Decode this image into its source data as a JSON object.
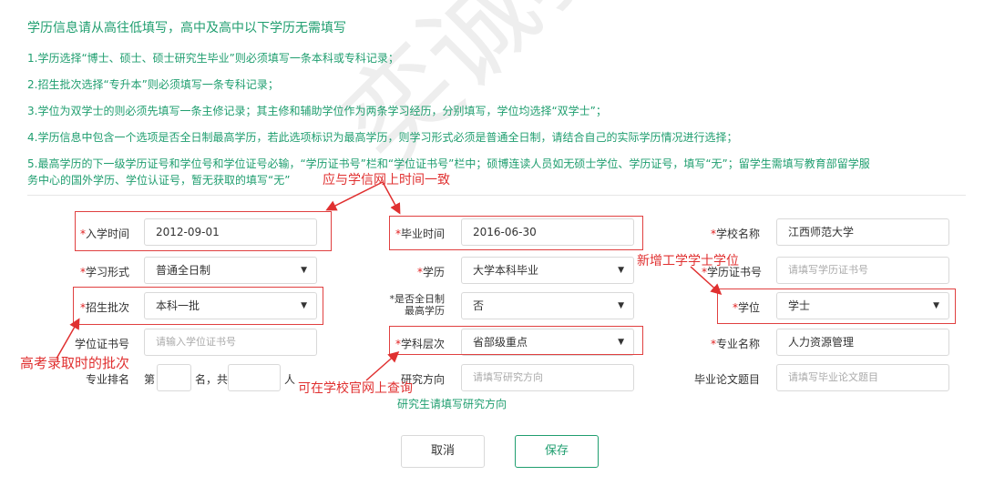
{
  "header": {
    "title": "学历信息请从高往低填写，高中及高中以下学历无需填写"
  },
  "notes": [
    "1.学历选择“博士、硕士、硕士研究生毕业”则必须填写一条本科或专科记录；",
    "2.招生批次选择“专升本”则必须填写一条专科记录；",
    "3.学位为双学士的则必须先填写一条主修记录；其主修和辅助学位作为两条学习经历，分别填写，学位均选择“双学士”；",
    "4.学历信息中包含一个选项是否全日制最高学历，若此选项标识为最高学历，则学习形式必须是普通全日制，请结合自己的实际学历情况进行选择；",
    "5.最高学历的下一级学历证号和学位号和学位证号必输，“学历证书号”栏和“学位证书号”栏中；硕博连读人员如无硕士学位、学历证号，填写“无”；留学生需填写教育部留学服",
    "务中心的国外学历、学位认证号，暂无获取的填写“无”"
  ],
  "form": {
    "enroll_time": {
      "label": "入学时间",
      "value": "2012-09-01"
    },
    "grad_time": {
      "label": "毕业时间",
      "value": "2016-06-30"
    },
    "school": {
      "label": "学校名称",
      "value": "江西师范大学"
    },
    "study_form": {
      "label": "学习形式",
      "value": "普通全日制"
    },
    "education": {
      "label": "学历",
      "value": "大学本科毕业"
    },
    "edu_cert": {
      "label": "学历证书号",
      "placeholder": "请填写学历证书号"
    },
    "batch": {
      "label": "招生批次",
      "value": "本科一批"
    },
    "fulltime_highest": {
      "label_line1": "是否全日制",
      "label_line2": "最高学历",
      "value": "否"
    },
    "degree": {
      "label": "学位",
      "value": "学士"
    },
    "degree_cert": {
      "label": "学位证书号",
      "placeholder": "请输入学位证书号"
    },
    "discipline": {
      "label": "学科层次",
      "value": "省部级重点"
    },
    "major": {
      "label": "专业名称",
      "value": "人力资源管理"
    },
    "rank": {
      "label": "专业排名",
      "prefix": "第",
      "mid": "名，共",
      "suffix": "人"
    },
    "research": {
      "label": "研究方向",
      "placeholder": "请填写研究方向"
    },
    "thesis": {
      "label": "毕业论文题目",
      "placeholder": "请填写毕业论文题目"
    }
  },
  "annotations": {
    "time_note": "应与学信网上时间一致",
    "degree_note": "新增工学学士学位",
    "batch_note": "高考录取时的批次",
    "discipline_note": "可在学校官网上查询",
    "research_note": "研究生请填写研究方向"
  },
  "buttons": {
    "cancel": "取消",
    "save": "保存"
  },
  "watermark": "奕诚教育",
  "star": "*",
  "caret": "▼",
  "colors": {
    "accent": "#1f9e6f",
    "annotation": "#e03030"
  }
}
